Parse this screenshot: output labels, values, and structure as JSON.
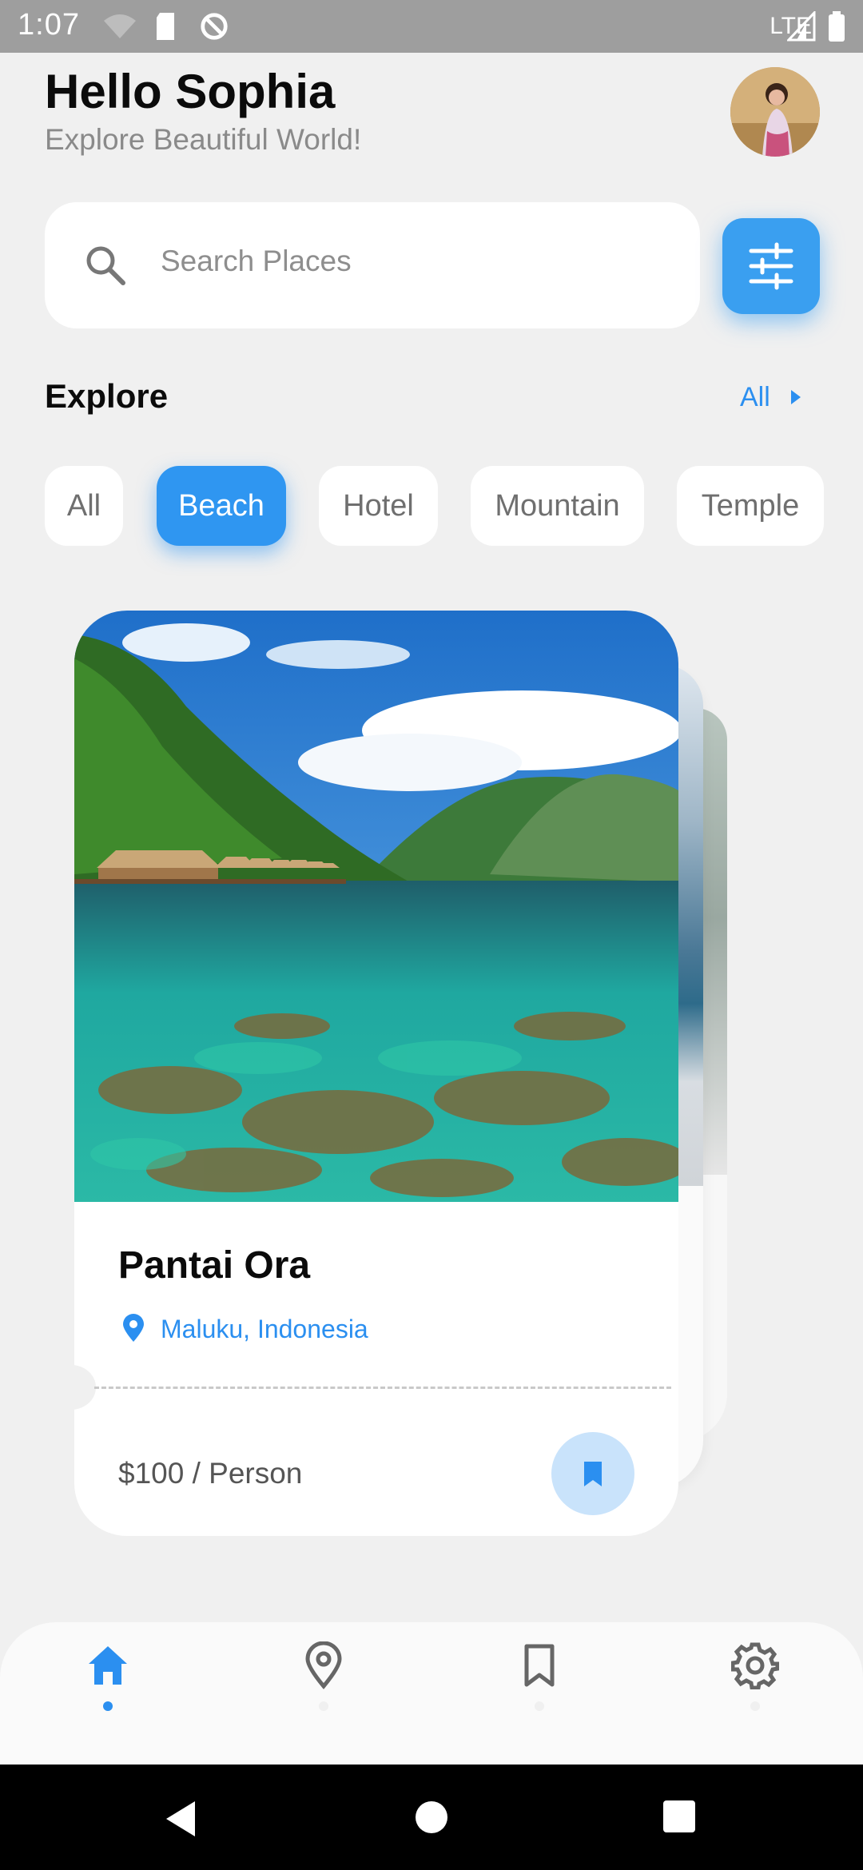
{
  "status_bar": {
    "time": "1:07",
    "network": "LTE"
  },
  "header": {
    "greeting": "Hello Sophia",
    "subtitle": "Explore Beautiful World!"
  },
  "search": {
    "placeholder": "Search Places"
  },
  "explore": {
    "title": "Explore",
    "see_all": "All",
    "categories": [
      {
        "label": "All",
        "selected": false
      },
      {
        "label": "Beach",
        "selected": true
      },
      {
        "label": "Hotel",
        "selected": false
      },
      {
        "label": "Mountain",
        "selected": false
      },
      {
        "label": "Temple",
        "selected": false
      }
    ]
  },
  "card": {
    "name": "Pantai Ora",
    "location": "Maluku, Indonesia",
    "price": "$100 / Person"
  },
  "bottom_nav": {
    "items": [
      {
        "icon": "home-icon",
        "active": true
      },
      {
        "icon": "location-pin-icon",
        "active": false
      },
      {
        "icon": "bookmark-icon",
        "active": false
      },
      {
        "icon": "settings-gear-icon",
        "active": false
      }
    ]
  },
  "colors": {
    "accent": "#2f96f1",
    "background": "#f0f0f0",
    "card": "#ffffff"
  }
}
